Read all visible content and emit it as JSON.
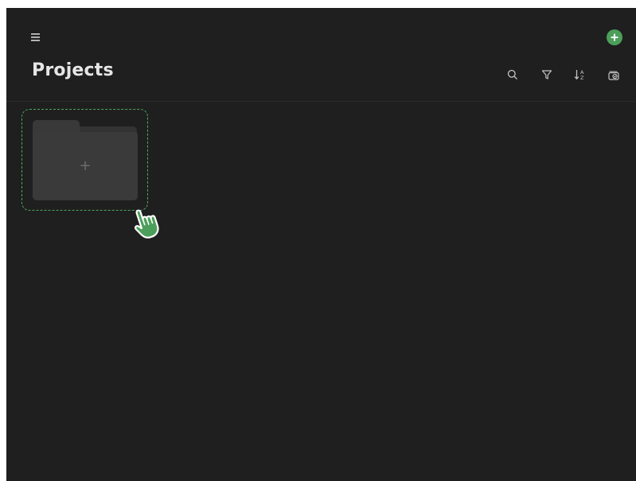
{
  "header": {
    "title": "Projects",
    "icons": {
      "menu": "hamburger-menu-icon",
      "add": "add-circle-icon",
      "search": "search-icon",
      "filter": "filter-icon",
      "sort": "sort-az-icon",
      "select": "select-check-icon"
    }
  },
  "main": {
    "new_folder_card": {
      "icon": "folder-plus-icon",
      "plus_label": "+"
    },
    "cursor": "hand-pointer-cursor"
  },
  "colors": {
    "background": "#1f1f1f",
    "accent": "#4c9f5a",
    "dashed_border": "#4ea85f",
    "title_text": "#e6e6e6",
    "icon": "#bdbdbd",
    "folder": "#3a3a3a"
  }
}
